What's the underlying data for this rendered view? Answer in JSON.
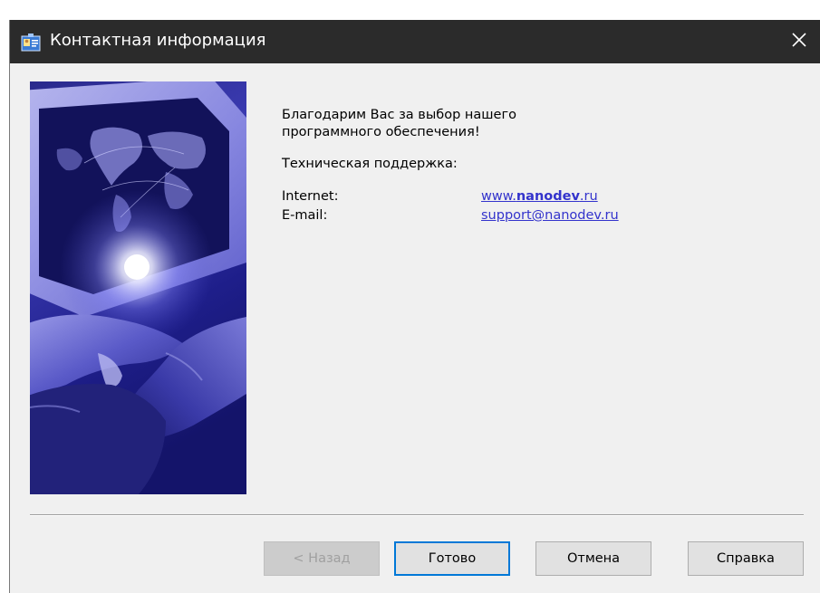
{
  "window": {
    "title": "Контактная информация"
  },
  "content": {
    "thanks_line1": "Благодарим Вас за выбор нашего",
    "thanks_line2": "программного обеспечения!",
    "support_label": "Техническая поддержка:",
    "internet_label": "Internet:",
    "internet_value_prefix": "www.",
    "internet_value_bold": "nanodev",
    "internet_value_suffix": ".ru",
    "email_label": "E-mail:",
    "email_value": "support@nanodev.ru"
  },
  "buttons": {
    "back": "< Назад",
    "finish": "Готово",
    "cancel": "Отмена",
    "help": "Справка"
  },
  "colors": {
    "titlebar": "#2b2b2b",
    "link": "#3333cc",
    "dialog_bg": "#f0f0f0",
    "default_button_border": "#0078d7"
  },
  "icons": {
    "title": "contact-card-icon",
    "close": "close-icon",
    "banner": "handshake-globe-image"
  }
}
